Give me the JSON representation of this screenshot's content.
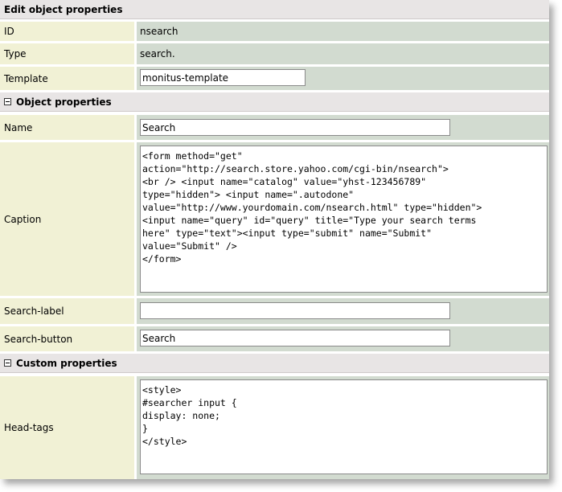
{
  "header": {
    "title": "Edit object properties"
  },
  "fields": {
    "id": {
      "label": "ID",
      "value": "nsearch"
    },
    "type": {
      "label": "Type",
      "value": "search."
    },
    "template": {
      "label": "Template",
      "value": "monitus-template"
    }
  },
  "object_properties": {
    "title": "Object properties",
    "name": {
      "label": "Name",
      "value": "Search"
    },
    "caption": {
      "label": "Caption",
      "value": "<form method=\"get\"\naction=\"http://search.store.yahoo.com/cgi-bin/nsearch\">\n<br /> <input name=\"catalog\" value=\"yhst-123456789\"\ntype=\"hidden\"> <input name=\".autodone\"\nvalue=\"http://www.yourdomain.com/nsearch.html\" type=\"hidden\">\n<input name=\"query\" id=\"query\" title=\"Type your search terms\nhere\" type=\"text\"><input type=\"submit\" name=\"Submit\"\nvalue=\"Submit\" />\n</form>"
    },
    "search_label": {
      "label": "Search-label",
      "value": ""
    },
    "search_button": {
      "label": "Search-button",
      "value": "Search"
    }
  },
  "custom_properties": {
    "title": "Custom properties",
    "head_tags": {
      "label": "Head-tags",
      "value": "<style>\n#searcher input {\ndisplay: none;\n}\n</style>"
    }
  },
  "icons": {
    "section_toggle": "minus-box-icon"
  },
  "colors": {
    "header_bg": "#e8e5e5",
    "label_bg": "#f1f1d5",
    "value_bg": "#d2dbd0"
  }
}
